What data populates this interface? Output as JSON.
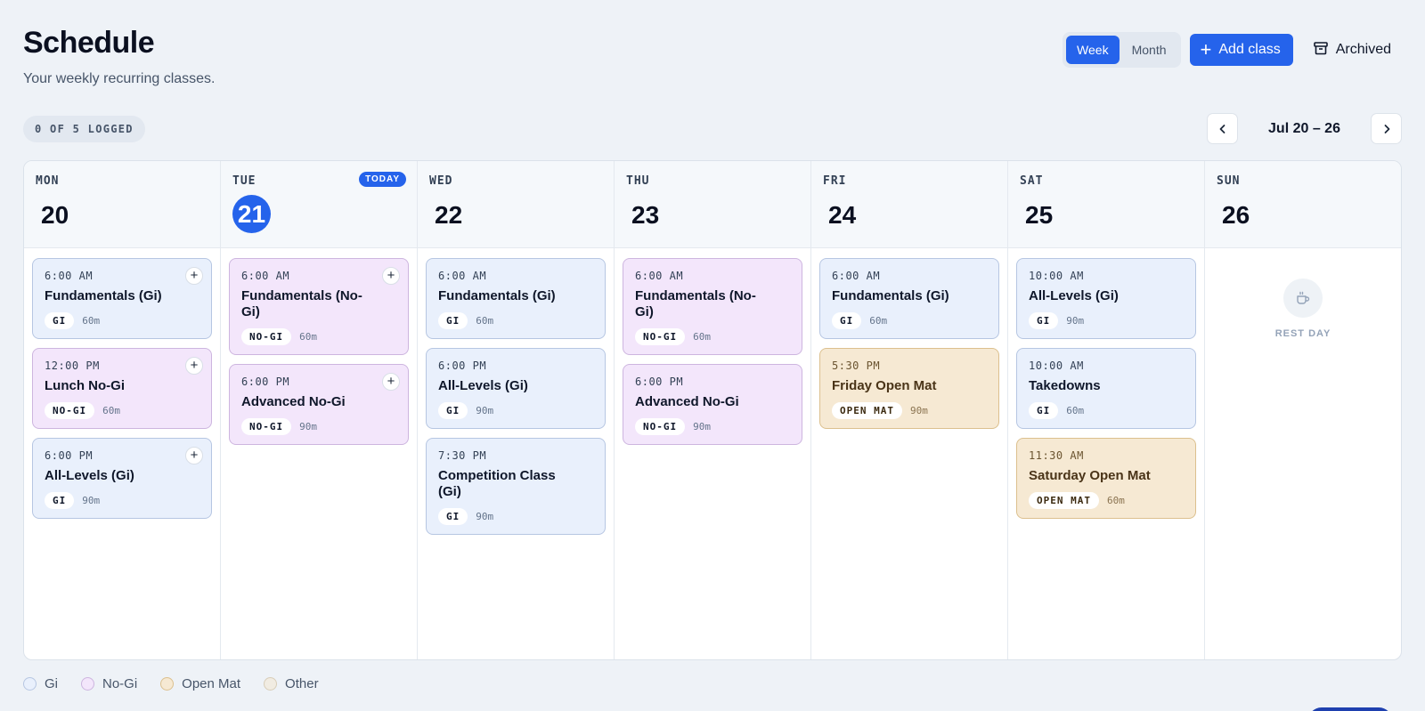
{
  "header": {
    "title": "Schedule",
    "subtitle": "Your weekly recurring classes."
  },
  "view_toggle": {
    "week": "Week",
    "month": "Month",
    "selected": "Week"
  },
  "actions": {
    "add_class": "Add class",
    "archived": "Archived"
  },
  "logged_status": "0 OF 5 LOGGED",
  "week_range": "Jul 20 – 26",
  "today_badge": "TODAY",
  "rest_day_label": "REST DAY",
  "days": [
    {
      "name": "MON",
      "num": "20"
    },
    {
      "name": "TUE",
      "num": "21"
    },
    {
      "name": "WED",
      "num": "22"
    },
    {
      "name": "THU",
      "num": "23"
    },
    {
      "name": "FRI",
      "num": "24"
    },
    {
      "name": "SAT",
      "num": "25"
    },
    {
      "name": "SUN",
      "num": "26"
    }
  ],
  "classes": {
    "mon": [
      {
        "time": "6:00 AM",
        "title": "Fundamentals (Gi)",
        "tag": "GI",
        "duration": "60m"
      },
      {
        "time": "12:00 PM",
        "title": "Lunch No-Gi",
        "tag": "NO-GI",
        "duration": "60m"
      },
      {
        "time": "6:00 PM",
        "title": "All-Levels (Gi)",
        "tag": "GI",
        "duration": "90m"
      }
    ],
    "tue": [
      {
        "time": "6:00 AM",
        "title": "Fundamentals (No-Gi)",
        "tag": "NO-GI",
        "duration": "60m"
      },
      {
        "time": "6:00 PM",
        "title": "Advanced No-Gi",
        "tag": "NO-GI",
        "duration": "90m"
      }
    ],
    "wed": [
      {
        "time": "6:00 AM",
        "title": "Fundamentals (Gi)",
        "tag": "GI",
        "duration": "60m"
      },
      {
        "time": "6:00 PM",
        "title": "All-Levels (Gi)",
        "tag": "GI",
        "duration": "90m"
      },
      {
        "time": "7:30 PM",
        "title": "Competition Class (Gi)",
        "tag": "GI",
        "duration": "90m"
      }
    ],
    "thu": [
      {
        "time": "6:00 AM",
        "title": "Fundamentals (No-Gi)",
        "tag": "NO-GI",
        "duration": "60m"
      },
      {
        "time": "6:00 PM",
        "title": "Advanced No-Gi",
        "tag": "NO-GI",
        "duration": "90m"
      }
    ],
    "fri": [
      {
        "time": "6:00 AM",
        "title": "Fundamentals (Gi)",
        "tag": "GI",
        "duration": "60m"
      },
      {
        "time": "5:30 PM",
        "title": "Friday Open Mat",
        "tag": "OPEN MAT",
        "duration": "90m"
      }
    ],
    "sat": [
      {
        "time": "10:00 AM",
        "title": "All-Levels (Gi)",
        "tag": "GI",
        "duration": "90m"
      },
      {
        "time": "10:00 AM",
        "title": "Takedowns",
        "tag": "GI",
        "duration": "60m"
      },
      {
        "time": "11:30 AM",
        "title": "Saturday Open Mat",
        "tag": "OPEN MAT",
        "duration": "60m"
      }
    ]
  },
  "legend": [
    {
      "label": "Gi",
      "color": "#e9f0fc",
      "border": "#b6c6e2"
    },
    {
      "label": "No-Gi",
      "color": "#f3e6fb",
      "border": "#cdb5df"
    },
    {
      "label": "Open Mat",
      "color": "#f6e9d3",
      "border": "#dcc08e"
    },
    {
      "label": "Other",
      "color": "#f1ece2",
      "border": "#d8cdb8"
    }
  ],
  "icons": {
    "add": "plus-icon",
    "archived": "archive-box-icon",
    "prev": "chevron-left-icon",
    "next": "chevron-right-icon",
    "log": "plus-icon",
    "rest": "coffee-cup-icon"
  },
  "colors": {
    "accent": "#2563eb"
  }
}
